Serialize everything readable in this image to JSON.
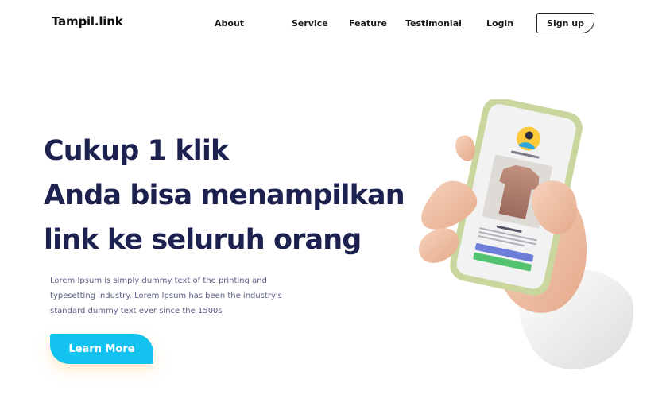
{
  "header": {
    "logo": "Tampil.link",
    "nav": {
      "about": "About",
      "service": "Service",
      "feature": "Feature",
      "testimonial": "Testimonial",
      "login": "Login"
    },
    "signup": "Sign up"
  },
  "hero": {
    "line1": "Cukup 1 klik",
    "line2": "Anda bisa menampilkan",
    "line3": "link ke seluruh orang",
    "description": "Lorem Ipsum is simply dummy text of the printing and typesetting industry. Lorem Ipsum has been the industry's standard dummy text ever since the 1500s",
    "cta": "Learn More"
  },
  "colors": {
    "heading": "#1c2150",
    "cta": "#13c2ee",
    "body_text": "#5b5f86"
  }
}
